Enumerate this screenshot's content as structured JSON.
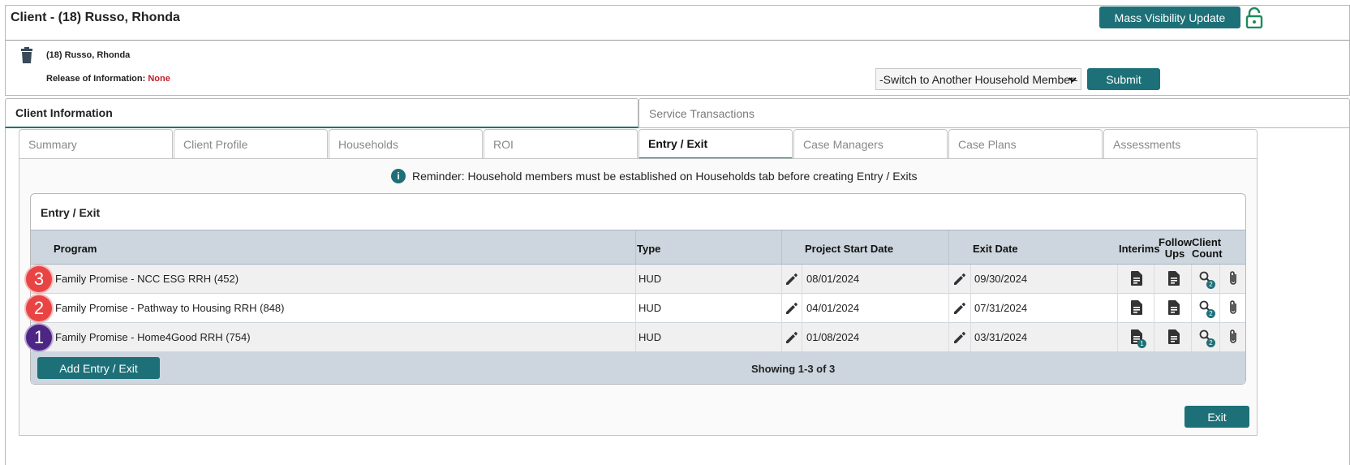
{
  "header": {
    "title": "Client - (18) Russo, Rhonda",
    "mass_visibility_label": "Mass Visibility Update"
  },
  "client": {
    "name": "(18) Russo, Rhonda",
    "roi_label": "Release of Information:",
    "roi_value": "None",
    "switch_select_value": "-Switch to Another Household Member-",
    "submit_label": "Submit"
  },
  "top_tabs": [
    "Client Information",
    "Service Transactions"
  ],
  "sub_tabs": [
    "Summary",
    "Client Profile",
    "Households",
    "ROI",
    "Entry / Exit",
    "Case Managers",
    "Case Plans",
    "Assessments"
  ],
  "active_sub_tab": "Entry / Exit",
  "reminder": "Reminder: Household members must be established on Households tab before creating Entry / Exits",
  "card": {
    "title": "Entry / Exit",
    "columns": {
      "program": "Program",
      "type": "Type",
      "start": "Project Start Date",
      "exit": "Exit Date",
      "interims": "Interims",
      "follow_ups": "Follow Ups",
      "client_count": "Client Count"
    },
    "rows": [
      {
        "marker": "3",
        "program": "Family Promise - NCC ESG RRH (452)",
        "type": "HUD",
        "start": "08/01/2024",
        "exit": "09/30/2024",
        "interims_badge": "",
        "count_badge": "2"
      },
      {
        "marker": "2",
        "program": "Family Promise - Pathway to Housing RRH (848)",
        "type": "HUD",
        "start": "04/01/2024",
        "exit": "07/31/2024",
        "interims_badge": "",
        "count_badge": "2"
      },
      {
        "marker": "1",
        "program": "Family Promise - Home4Good RRH (754)",
        "type": "HUD",
        "start": "01/08/2024",
        "exit": "03/31/2024",
        "interims_badge": "1",
        "count_badge": "2"
      }
    ],
    "add_label": "Add Entry / Exit",
    "showing": "Showing 1-3 of 3"
  },
  "exit_label": "Exit",
  "colors": {
    "accent": "#1e7078",
    "marker_red": "#e94444",
    "marker_purple": "#4d2584",
    "none_red": "#c0202a"
  }
}
